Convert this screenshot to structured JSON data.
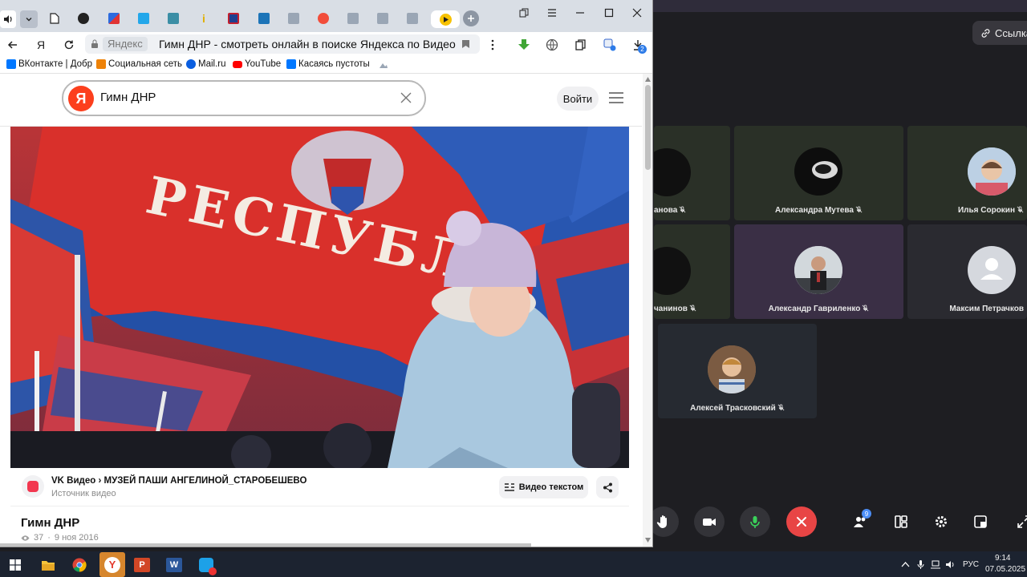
{
  "browser": {
    "address_host": "Яндекс",
    "page_title": "Гимн ДНР - смотреть онлайн в поиске Яндекса по Видео",
    "download_badge": "2",
    "tabs": [
      {
        "icon": "speaker-icon"
      },
      {
        "icon": "more-tabs-chevron-icon"
      },
      {
        "icon": "document-icon"
      },
      {
        "icon": "clock-icon"
      },
      {
        "icon": "translate-icon"
      },
      {
        "icon": "app-icon"
      },
      {
        "icon": "docs-icon"
      },
      {
        "icon": "info-icon"
      },
      {
        "icon": "uk-flag-icon"
      },
      {
        "icon": "book-icon"
      },
      {
        "icon": "image-icon"
      },
      {
        "icon": "yandex-icon"
      },
      {
        "icon": "image-icon"
      },
      {
        "icon": "image-icon"
      },
      {
        "icon": "image-icon"
      }
    ],
    "bookmarks": [
      {
        "label": "ВКонтакте | Добр",
        "icon": "vk-icon",
        "color": "#0077ff"
      },
      {
        "label": "Социальная сеть",
        "icon": "ok-icon",
        "color": "#ee8208"
      },
      {
        "label": "Mail.ru",
        "icon": "mail-icon",
        "color": "#0a5ee0"
      },
      {
        "label": "YouTube",
        "icon": "youtube-icon",
        "color": "#ff0000"
      },
      {
        "label": "Касаясь пустоты",
        "icon": "vk-icon",
        "color": "#0077ff"
      }
    ]
  },
  "search": {
    "query": "Гимн ДНР",
    "logo_letter": "Я",
    "login_label": "Войти"
  },
  "video": {
    "source_title": "VK Видео › МУЗЕЙ ПАШИ АНГЕЛИНОЙ_СТАРОБЕШЕВО",
    "source_subtitle": "Источник видео",
    "text_button_label": "Видео текстом",
    "title": "Гимн ДНР",
    "views": "37",
    "date": "9 ноя 2016",
    "flag_text": "РЕСПУБЛ"
  },
  "conference": {
    "link_button_label": "Ссылка",
    "participants": [
      {
        "name": "анова",
        "avatar": "dark"
      },
      {
        "name": "Александра Мутева",
        "avatar": "dark-helmet"
      },
      {
        "name": "Илья Сорокин",
        "avatar": "photo"
      },
      {
        "name": "чанинов",
        "avatar": "dark"
      },
      {
        "name": "Александр Гавриленко",
        "avatar": "photo"
      },
      {
        "name": "Максим Петрачков",
        "avatar": "placeholder"
      },
      {
        "name": "Алексей Трасковский",
        "avatar": "photo"
      }
    ],
    "participants_count": "9",
    "accent_end_call": "#e84545"
  },
  "taskbar": {
    "language": "РУС",
    "time": "9:14",
    "date": "07.05.2025"
  }
}
